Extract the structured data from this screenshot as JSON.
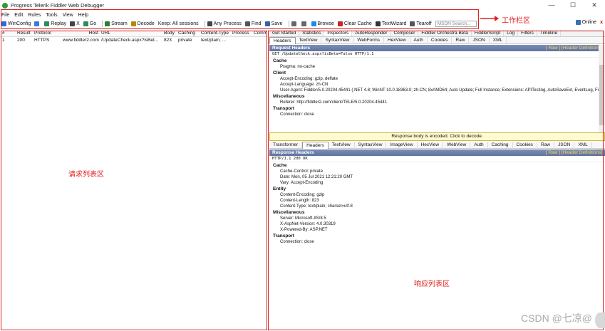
{
  "window": {
    "title": "Progress Telerik Fiddler Web Debugger",
    "minimize": "—",
    "maximize": "☐",
    "close": "✕"
  },
  "menu": [
    "File",
    "Edit",
    "Rules",
    "Tools",
    "View",
    "Help"
  ],
  "toolbar": {
    "items": [
      {
        "label": "WinConfig",
        "icon": "windows-icon",
        "color": "#2b6fd1"
      },
      {
        "label": "",
        "icon": "comment-icon",
        "color": "#3a7bd5"
      },
      {
        "label": "Replay",
        "icon": "replay-icon",
        "color": "#2e8b57"
      },
      {
        "label": "X",
        "icon": "remove-icon",
        "color": "#444"
      },
      {
        "label": "Go",
        "icon": "go-icon",
        "color": "#2e8b57"
      },
      {
        "label": "Stream",
        "icon": "stream-icon",
        "color": "#2e7d32"
      },
      {
        "label": "Decode",
        "icon": "decode-icon",
        "color": "#b58900"
      },
      {
        "label": "Keep: All sessions",
        "icon": "",
        "color": ""
      },
      {
        "label": "Any Process",
        "icon": "target-icon",
        "color": "#444"
      },
      {
        "label": "Find",
        "icon": "find-icon",
        "color": "#555"
      },
      {
        "label": "Save",
        "icon": "save-icon",
        "color": "#3a5fa0"
      },
      {
        "label": "",
        "icon": "camera-icon",
        "color": "#666"
      },
      {
        "label": "",
        "icon": "timer-icon",
        "color": "#666"
      },
      {
        "label": "Browse",
        "icon": "browse-icon",
        "color": "#1e88e5"
      },
      {
        "label": "Clear Cache",
        "icon": "clear-cache-icon",
        "color": "#c62828"
      },
      {
        "label": "TextWizard",
        "icon": "textwizard-icon",
        "color": "#333"
      },
      {
        "label": "Tearoff",
        "icon": "tearoff-icon",
        "color": "#555"
      }
    ],
    "msdn_placeholder": "MSDN Search...",
    "online_label": "Online"
  },
  "annotations": {
    "toolbar_zone": "工作栏区",
    "request_zone": "请求列表区",
    "response_zone": "响应列表区"
  },
  "session_list": {
    "columns": [
      "#",
      "Result",
      "Protocol",
      "Host",
      "URL",
      "Body",
      "Caching",
      "Content-Type",
      "Process",
      "Comm"
    ],
    "rows": [
      [
        "1",
        "200",
        "HTTPS",
        "www.fiddler2.com",
        "/UpdateCheck.aspx?isBet...",
        "823",
        "private",
        "text/plain; ...",
        "",
        ""
      ]
    ]
  },
  "top_tabs": [
    "Get Started",
    "Statistics",
    "Inspectors",
    "AutoResponder",
    "Composer",
    "Fiddler Orchestra Beta",
    "FiddlerScript",
    "Log",
    "Filters",
    "Timeline"
  ],
  "request_tabs": [
    "Headers",
    "TextView",
    "SyntaxView",
    "WebForms",
    "HexView",
    "Auth",
    "Cookies",
    "Raw",
    "JSON",
    "XML"
  ],
  "request": {
    "section_title": "Request Headers",
    "raw_link": "[ Raw ]",
    "defs_link": "[Header Definitions]",
    "request_line": "GET /UpdateCheck.aspx?isBeta=False HTTP/1.1",
    "groups": [
      {
        "name": "Cache",
        "lines": [
          "Pragma: no-cache"
        ]
      },
      {
        "name": "Client",
        "lines": [
          "Accept-Encoding: gzip, deflate",
          "Accept-Language: zh-CN",
          "User-Agent: Fiddler/5.0.20204.45441 (.NET 4.8; WinNT 10.0.18363.0; zh-CN; 8xAMD64; Auto Update; Full Instance; Extensions: APITesting, AutoSaveExt, EventLog, Fi"
        ]
      },
      {
        "name": "Miscellaneous",
        "lines": [
          "Referer: http://fiddler2.com/client/TELE/5.0.20204.45441"
        ]
      },
      {
        "name": "Transport",
        "lines": [
          "Connection: close"
        ]
      }
    ]
  },
  "encoded_notice": "Response body is encoded. Click to decode.",
  "response_tabs": [
    "Transformer",
    "Headers",
    "TextView",
    "SyntaxView",
    "ImageView",
    "HexView",
    "WebView",
    "Auth",
    "Caching",
    "Cookies",
    "Raw",
    "JSON",
    "XML"
  ],
  "response": {
    "section_title": "Response Headers",
    "raw_link": "[ Raw ]",
    "defs_link": "[Header Definitions]",
    "status_line": "HTTP/1.1 200 OK",
    "groups": [
      {
        "name": "Cache",
        "lines": [
          "Cache-Control: private",
          "Date: Mon, 05 Jul 2021 12:21:20 GMT",
          "Vary: Accept-Encoding"
        ]
      },
      {
        "name": "Entity",
        "lines": [
          "Content-Encoding: gzip",
          "Content-Length: 823",
          "Content-Type: text/plain; charset=utf-8"
        ]
      },
      {
        "name": "Miscellaneous",
        "lines": [
          "Server: Microsoft-IIS/8.5",
          "X-AspNet-Version: 4.0.30319",
          "X-Powered-By: ASP.NET"
        ]
      },
      {
        "name": "Transport",
        "lines": [
          "Connection: close"
        ]
      }
    ]
  },
  "watermark": "CSDN @七凉@"
}
